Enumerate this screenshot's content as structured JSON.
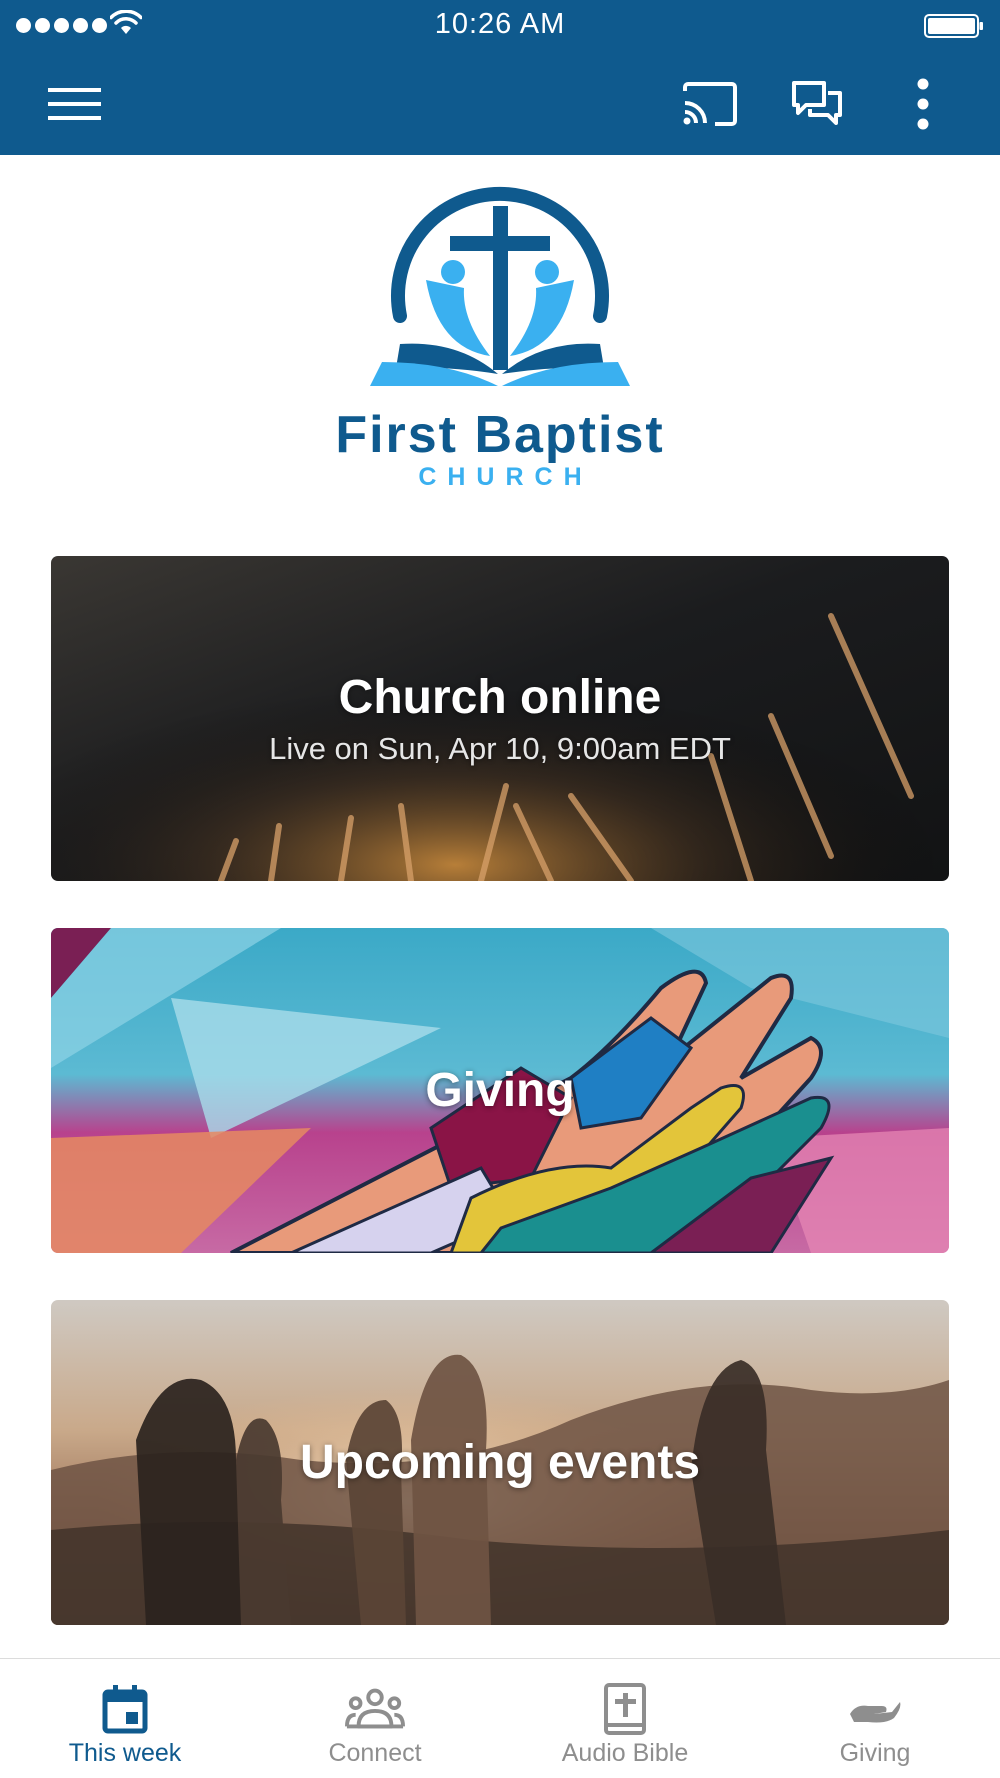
{
  "status_bar": {
    "time": "10:26 AM"
  },
  "app_bar": {
    "icons": [
      "menu-icon",
      "cast-icon",
      "chat-icon",
      "more-vertical-icon"
    ]
  },
  "logo": {
    "title": "First Baptist",
    "subtitle": "CHURCH"
  },
  "cards": [
    {
      "title": "Church online",
      "subtitle": "Live on Sun, Apr 10, 9:00am EDT"
    },
    {
      "title": "Giving"
    },
    {
      "title": "Upcoming events"
    }
  ],
  "bottom_nav": [
    {
      "label": "This week",
      "icon": "calendar-icon",
      "active": true
    },
    {
      "label": "Connect",
      "icon": "group-icon",
      "active": false
    },
    {
      "label": "Audio Bible",
      "icon": "bible-icon",
      "active": false
    },
    {
      "label": "Giving",
      "icon": "giving-hand-icon",
      "active": false
    }
  ],
  "colors": {
    "primary": "#0f5a8e",
    "accent": "#3ab0f0",
    "inactive": "#8e8e8e"
  }
}
